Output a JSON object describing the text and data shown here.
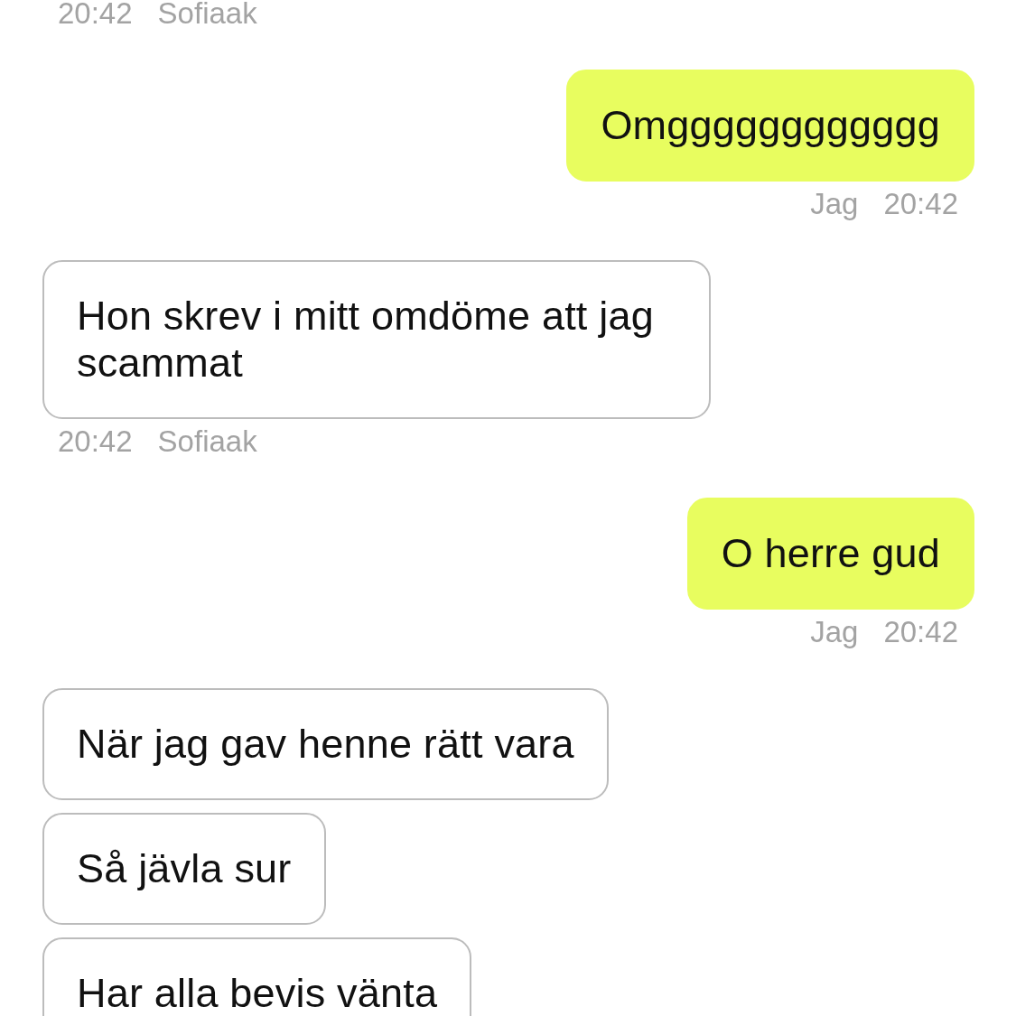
{
  "feed": [
    {
      "kind": "meta",
      "outgoing": false,
      "time": "20:42",
      "sender": "Sofiaak"
    },
    {
      "kind": "message",
      "outgoing": true,
      "text": "Omgggggggggggg"
    },
    {
      "kind": "meta",
      "outgoing": true,
      "time": "20:42",
      "sender": "Jag"
    },
    {
      "kind": "message",
      "outgoing": false,
      "text": "Hon skrev i mitt omdöme att jag scammat"
    },
    {
      "kind": "meta",
      "outgoing": false,
      "time": "20:42",
      "sender": "Sofiaak"
    },
    {
      "kind": "message",
      "outgoing": true,
      "text": "O herre gud"
    },
    {
      "kind": "meta",
      "outgoing": true,
      "time": "20:42",
      "sender": "Jag"
    },
    {
      "kind": "message",
      "outgoing": false,
      "text": "När jag gav henne rätt vara"
    },
    {
      "kind": "message",
      "outgoing": false,
      "text": "Så jävla sur"
    },
    {
      "kind": "message",
      "outgoing": false,
      "text": "Har alla bevis vänta"
    }
  ]
}
